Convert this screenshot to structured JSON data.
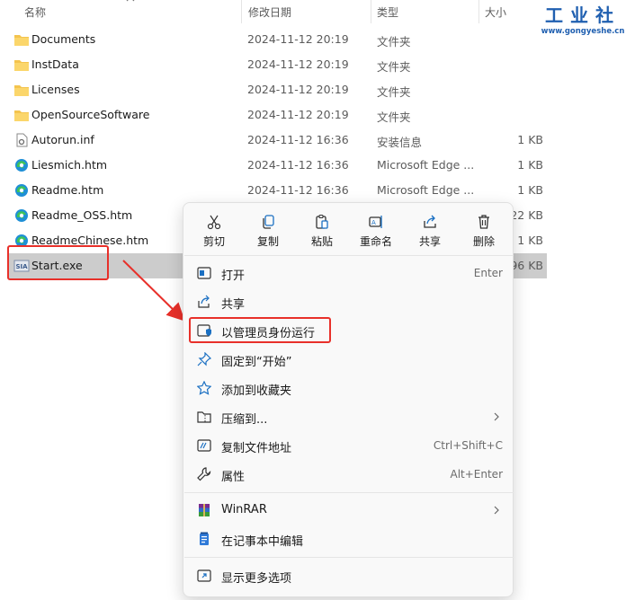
{
  "columns": {
    "name": "名称",
    "date": "修改日期",
    "type": "类型",
    "size": "大小"
  },
  "logo": {
    "text": "工业社",
    "url": "www.gongyeshe.cn"
  },
  "files": [
    {
      "name": "Documents",
      "date": "2024-11-12 20:19",
      "type": "文件夹",
      "size": "",
      "icon": "folder-icon"
    },
    {
      "name": "InstData",
      "date": "2024-11-12 20:19",
      "type": "文件夹",
      "size": "",
      "icon": "folder-icon"
    },
    {
      "name": "Licenses",
      "date": "2024-11-12 20:19",
      "type": "文件夹",
      "size": "",
      "icon": "folder-icon"
    },
    {
      "name": "OpenSourceSoftware",
      "date": "2024-11-12 20:19",
      "type": "文件夹",
      "size": "",
      "icon": "folder-icon"
    },
    {
      "name": "Autorun.inf",
      "date": "2024-11-12 16:36",
      "type": "安装信息",
      "size": "1 KB",
      "icon": "settings-file-icon"
    },
    {
      "name": "Liesmich.htm",
      "date": "2024-11-12 16:36",
      "type": "Microsoft Edge ...",
      "size": "1 KB",
      "icon": "edge-icon"
    },
    {
      "name": "Readme.htm",
      "date": "2024-11-12 16:36",
      "type": "Microsoft Edge ...",
      "size": "1 KB",
      "icon": "edge-icon"
    },
    {
      "name": "Readme_OSS.htm",
      "date": "",
      "type": "",
      "size": "22 KB",
      "icon": "edge-icon"
    },
    {
      "name": "ReadmeChinese.htm",
      "date": "",
      "type": "",
      "size": "1 KB",
      "icon": "edge-icon"
    },
    {
      "name": "Start.exe",
      "date": "",
      "type": "",
      "size": "96 KB",
      "icon": "siemens-exe-icon"
    }
  ],
  "quick_actions": [
    {
      "label": "剪切",
      "icon": "scissors-icon"
    },
    {
      "label": "复制",
      "icon": "copy-icon"
    },
    {
      "label": "粘贴",
      "icon": "paste-icon"
    },
    {
      "label": "重命名",
      "icon": "rename-icon"
    },
    {
      "label": "共享",
      "icon": "share-icon"
    },
    {
      "label": "删除",
      "icon": "trash-icon"
    }
  ],
  "menu": {
    "open": {
      "label": "打开",
      "shortcut": "Enter",
      "icon": "open-window-icon"
    },
    "share": {
      "label": "共享",
      "icon": "share-icon"
    },
    "run_as_admin": {
      "label": "以管理员身份运行",
      "icon": "shield-window-icon"
    },
    "pin_start": {
      "label": "固定到“开始”",
      "icon": "pin-icon"
    },
    "add_favorites": {
      "label": "添加到收藏夹",
      "icon": "star-icon"
    },
    "compress": {
      "label": "压缩到...",
      "icon": "zip-icon"
    },
    "copy_path": {
      "label": "复制文件地址",
      "shortcut": "Ctrl+Shift+C",
      "icon": "copy-path-icon"
    },
    "properties": {
      "label": "属性",
      "shortcut": "Alt+Enter",
      "icon": "wrench-icon"
    },
    "winrar": {
      "label": "WinRAR",
      "icon": "winrar-icon"
    },
    "notepad": {
      "label": "在记事本中编辑",
      "icon": "notepad-icon"
    },
    "more_options": {
      "label": "显示更多选项",
      "icon": "more-options-icon"
    }
  },
  "colors": {
    "highlight": "#e8302a",
    "folder": "#f4c44e",
    "accent": "#0067c0",
    "selected_row": "#cccccc"
  }
}
